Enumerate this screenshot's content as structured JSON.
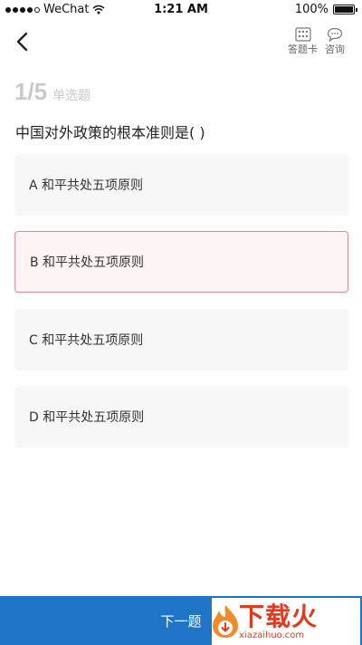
{
  "status_bar": {
    "carrier": "WeChat",
    "time": "1:21 AM",
    "battery": "100%",
    "battery_level": 1.0
  },
  "nav": {
    "back_icon": "back-arrow-icon",
    "card_label": "答题卡",
    "card_icon": "answer-card-icon",
    "consult_label": "咨询",
    "consult_icon": "chat-bubble-icon"
  },
  "question": {
    "progress": "1/5",
    "type": "单选题",
    "text": "中国对外政策的根本准则是(   )"
  },
  "options": [
    {
      "label": "A 和平共处五项原则",
      "selected": false
    },
    {
      "label": "B 和平共处五项原则",
      "selected": true
    },
    {
      "label": "C 和平共处五项原则",
      "selected": false
    },
    {
      "label": "D 和平共处五项原则",
      "selected": false
    }
  ],
  "footer": {
    "next_label": "下一题",
    "watermark_main": "下载火",
    "watermark_sub": "xiazaihuo.com"
  },
  "colors": {
    "primary": "#1e74c7",
    "selected_border": "#e88a8a",
    "watermark": "#e03a1f"
  }
}
